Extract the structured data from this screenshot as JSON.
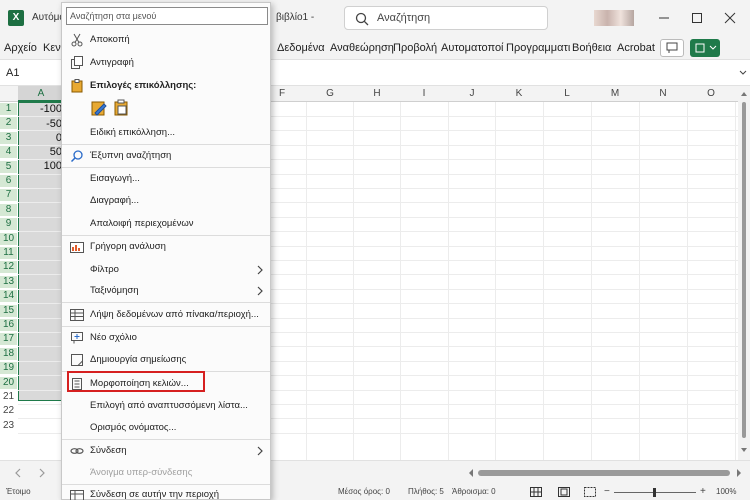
{
  "titlebar": {
    "app_icon_letter": "X",
    "autosave_label": "Αυτόματ",
    "doc_title": "βιβλίο1  -",
    "search_placeholder": "Αναζήτηση"
  },
  "menubar": {
    "items": [
      "Αρχείο",
      "Κεν",
      "Δεδομένα",
      "Αναθεώρηση",
      "Προβολή",
      "Αυτοματοποί",
      "Προγραμματι",
      "Βοήθεια",
      "Acrobat"
    ]
  },
  "formula_bar": {
    "name_box": "A1"
  },
  "grid": {
    "columns": [
      "A",
      "F",
      "G",
      "H",
      "I",
      "J",
      "K",
      "L",
      "M",
      "N",
      "O"
    ],
    "rows": [
      "1",
      "2",
      "3",
      "4",
      "5",
      "6",
      "7",
      "8",
      "9",
      "10",
      "11",
      "12",
      "13",
      "14",
      "15",
      "16",
      "17",
      "18",
      "19",
      "20",
      "21",
      "22",
      "23"
    ],
    "colA_values": [
      "-100",
      "-50",
      "0",
      "50",
      "100"
    ]
  },
  "context_menu": {
    "search_placeholder": "Αναζήτηση στα μενού",
    "cut": "Αποκοπή",
    "copy": "Αντιγραφή",
    "paste_options": "Επιλογές επικόλλησης:",
    "paste_special": "Ειδική επικόλληση...",
    "smart_lookup": "Έξυπνη αναζήτηση",
    "insert": "Εισαγωγή...",
    "delete": "Διαγραφή...",
    "clear_contents": "Απαλοιφή περιεχομένων",
    "quick_analysis": "Γρήγορη ανάλυση",
    "filter": "Φίλτρο",
    "sort": "Ταξινόμηση",
    "get_data": "Λήψη δεδομένων από πίνακα/περιοχή...",
    "new_comment": "Νέο σχόλιο",
    "new_note": "Δημιουργία σημείωσης",
    "format_cells": "Μορφοποίηση κελιών...",
    "pick_from_list": "Επιλογή από αναπτυσσόμενη λίστα...",
    "define_name": "Ορισμός ονόματος...",
    "link": "Σύνδεση",
    "open_hyperlink": "Άνοιγμα υπερ-σύνδεσης",
    "link_to_range": "Σύνδεση σε αυτήν την περιοχή"
  },
  "statusbar": {
    "ready": "Έτοιμο",
    "average": "Μέσος όρος: 0",
    "count": "Πλήθος: 5",
    "sum": "Άθροισμα: 0",
    "zoom": "100%"
  },
  "colors": {
    "excel_green": "#1d6f42",
    "highlight_red": "#d62020"
  }
}
